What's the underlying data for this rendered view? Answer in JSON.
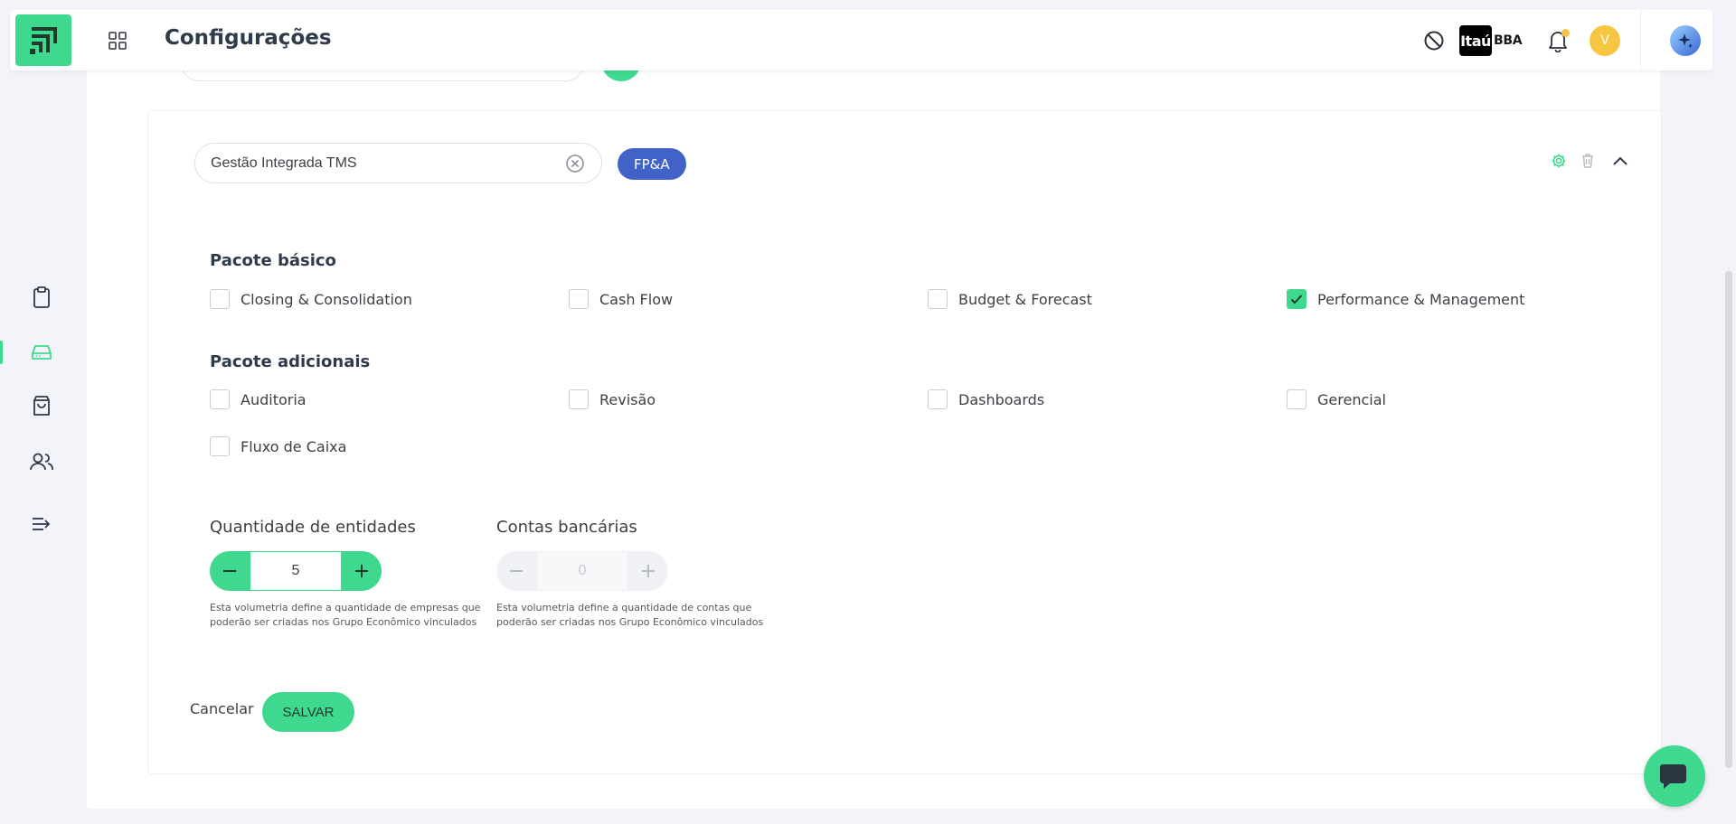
{
  "header": {
    "title": "Configurações",
    "brand_main": "Itaú",
    "brand_sub": "BBA",
    "avatar_initial": "V"
  },
  "card": {
    "name_value": "Gestão Integrada TMS",
    "tag": "FP&A"
  },
  "basic": {
    "title": "Pacote básico",
    "items": [
      {
        "label": "Closing & Consolidation",
        "checked": false
      },
      {
        "label": "Cash Flow",
        "checked": false
      },
      {
        "label": "Budget & Forecast",
        "checked": false
      },
      {
        "label": "Performance & Management",
        "checked": true
      }
    ]
  },
  "additional": {
    "title": "Pacote adicionais",
    "items": [
      {
        "label": "Auditoria",
        "checked": false
      },
      {
        "label": "Revisão",
        "checked": false
      },
      {
        "label": "Dashboards",
        "checked": false
      },
      {
        "label": "Gerencial",
        "checked": false
      },
      {
        "label": "Fluxo de Caixa",
        "checked": false
      }
    ]
  },
  "entities": {
    "label": "Quantidade de entidades",
    "value": "5",
    "hint": "Esta volumetria define a quantidade de empresas que poderão ser criadas nos Grupo Econômico vinculados"
  },
  "bank_accounts": {
    "label": "Contas bancárias",
    "value": "0",
    "hint": "Esta volumetria define a quantidade de contas que poderão ser criadas nos Grupo Econômico vinculados"
  },
  "actions": {
    "cancel": "Cancelar",
    "save": "SALVAR"
  },
  "colors": {
    "accent": "#3ed98e",
    "tag": "#4163c7"
  }
}
